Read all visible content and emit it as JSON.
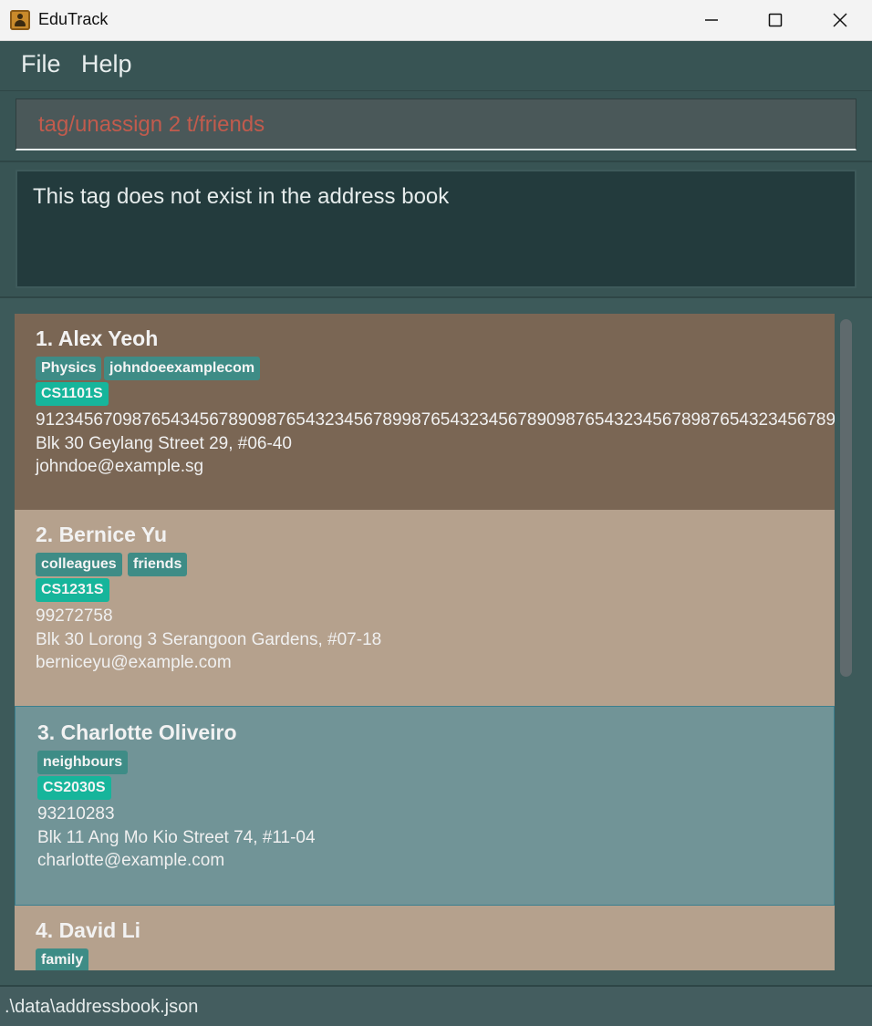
{
  "window": {
    "title": "EduTrack",
    "minimize_icon": "minimize-icon",
    "maximize_icon": "maximize-icon",
    "close_icon": "close-icon"
  },
  "menu": {
    "file": "File",
    "help": "Help"
  },
  "command": {
    "value": "tag/unassign 2 t/friends"
  },
  "result": {
    "message": "This tag does not exist in the address book"
  },
  "persons": [
    {
      "index_name": "1. Alex Yeoh",
      "tags": [
        "Physics",
        "johndoeexamplecom"
      ],
      "course": "CS1101S",
      "phone": "91234567098765434567890987654323456789987654323456789098765432345678987654323456789...",
      "address": "Blk 30 Geylang Street 29, #06-40",
      "email": "johndoe@example.sg",
      "bg": "#7a6654"
    },
    {
      "index_name": "2. Bernice Yu",
      "tags": [
        "colleagues",
        "friends"
      ],
      "course": "CS1231S",
      "phone": "99272758",
      "address": "Blk 30 Lorong 3 Serangoon Gardens, #07-18",
      "email": "berniceyu@example.com",
      "bg": "#b5a18d"
    },
    {
      "index_name": "3. Charlotte Oliveiro",
      "tags": [
        "neighbours"
      ],
      "course": "CS2030S",
      "phone": "93210283",
      "address": "Blk 11 Ang Mo Kio Street 74, #11-04",
      "email": "charlotte@example.com",
      "bg": "#719497",
      "selected": true
    },
    {
      "index_name": "4. David Li",
      "tags": [
        "family"
      ],
      "bg": "#b5a18d"
    }
  ],
  "status": {
    "file_path": ".\\data\\addressbook.json"
  }
}
